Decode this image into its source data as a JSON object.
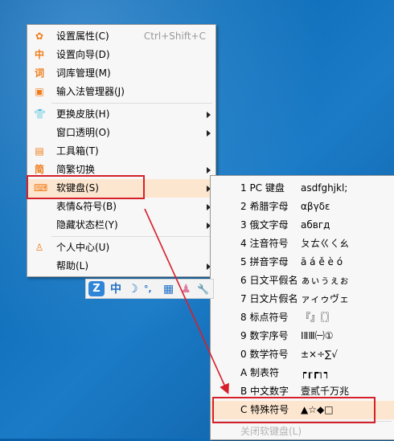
{
  "colors": {
    "accent": "#f07c1a",
    "highlight": "#fde6cf",
    "annotation_red": "#d6202a",
    "desktop_blue": "#0e6db8"
  },
  "main_menu": {
    "items": [
      {
        "icon": "gear-icon",
        "label": "设置属性(C)",
        "shortcut": "Ctrl+Shift+C",
        "submenu": false
      },
      {
        "icon": "wizard-icon",
        "label": "设置向导(D)",
        "submenu": false
      },
      {
        "icon": "dictionary-icon",
        "label": "词库管理(M)",
        "submenu": false
      },
      {
        "icon": "ime-manager-icon",
        "label": "输入法管理器(J)",
        "submenu": false
      },
      {
        "icon": "shirt-icon",
        "label": "更换皮肤(H)",
        "submenu": true
      },
      {
        "icon": "",
        "label": "窗口透明(O)",
        "submenu": true
      },
      {
        "icon": "toolbox-icon",
        "label": "工具箱(T)",
        "submenu": false
      },
      {
        "icon": "traditional-simplified-icon",
        "label": "简繁切换",
        "submenu": true
      },
      {
        "icon": "keyboard-icon",
        "label": "软键盘(S)",
        "submenu": true
      },
      {
        "icon": "",
        "label": "表情&符号(B)",
        "submenu": true
      },
      {
        "icon": "",
        "label": "隐藏状态栏(Y)",
        "submenu": true
      },
      {
        "icon": "user-icon",
        "label": "个人中心(U)",
        "submenu": false
      },
      {
        "icon": "",
        "label": "帮助(L)",
        "submenu": true
      }
    ]
  },
  "soft_keyboard_menu": {
    "items": [
      {
        "label": "1 PC 键盘",
        "sample": "asdfghjkl;"
      },
      {
        "label": "2 希腊字母",
        "sample": "αβγδε"
      },
      {
        "label": "3 俄文字母",
        "sample": "абвгд"
      },
      {
        "label": "4 注音符号",
        "sample": "ㄆㄊㄍㄑㄠ"
      },
      {
        "label": "5 拼音字母",
        "sample": "ā á ě è ó"
      },
      {
        "label": "6 日文平假名",
        "sample": "ぁぃぅぇぉ"
      },
      {
        "label": "7 日文片假名",
        "sample": "ァィゥヴェ"
      },
      {
        "label": "8 标点符号",
        "sample": "『』〖〗"
      },
      {
        "label": "9 数字序号",
        "sample": "ⅠⅡⅢ㈠①"
      },
      {
        "label": "0 数学符号",
        "sample": "±×÷∑√"
      },
      {
        "label": "A 制表符",
        "sample": "┍┎┏┐┑"
      },
      {
        "label": "B 中文数字",
        "sample": "壹贰千万兆"
      },
      {
        "label": "C 特殊符号",
        "sample": "▲☆◆□"
      },
      {
        "label": "关闭软键盘(L)",
        "sample": ""
      }
    ]
  },
  "ime_bar": {
    "logo": "Z",
    "lang": "中",
    "moon": "☽",
    "punct": "°,",
    "keyboard": "▦",
    "user": "♟",
    "tool": "🔧"
  }
}
